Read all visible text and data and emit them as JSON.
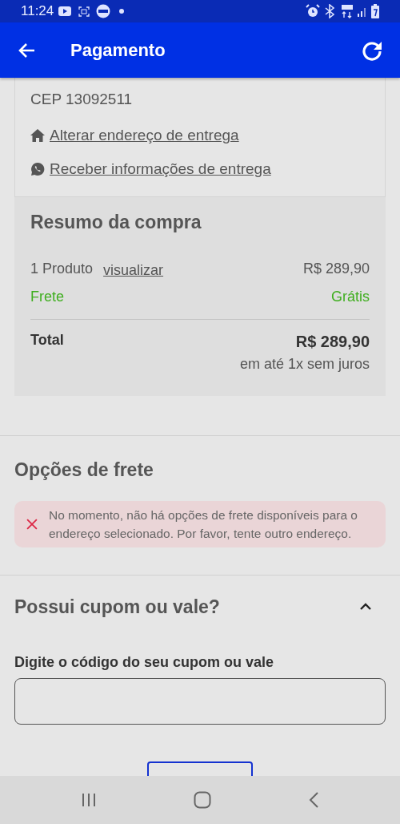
{
  "status_bar": {
    "time": "11:24"
  },
  "app_bar": {
    "title": "Pagamento"
  },
  "address": {
    "lines": [
      "CEP 13092511"
    ],
    "links": [
      {
        "kind": "home",
        "label": "Alterar endereço de entrega"
      },
      {
        "kind": "chat",
        "label": "Receber informações de entrega"
      }
    ]
  },
  "summary": {
    "title": "Resumo da compra",
    "product_label": "1 Produto",
    "view_link": "visualizar",
    "product_price": "R$ 289,90",
    "shipping_label": "Frete",
    "shipping_value": "Grátis",
    "total_label": "Total",
    "total_value": "R$ 289,90",
    "installments": "em até 1x sem juros"
  },
  "shipping_options": {
    "title": "Opções de frete",
    "error": "No momento, não há opções de frete disponíveis para o endereço selecionado. Por favor, tente outro endereço."
  },
  "coupon": {
    "title": "Possui cupom ou vale?",
    "expanded": true,
    "field_label": "Digite o código do seu cupom ou vale"
  }
}
